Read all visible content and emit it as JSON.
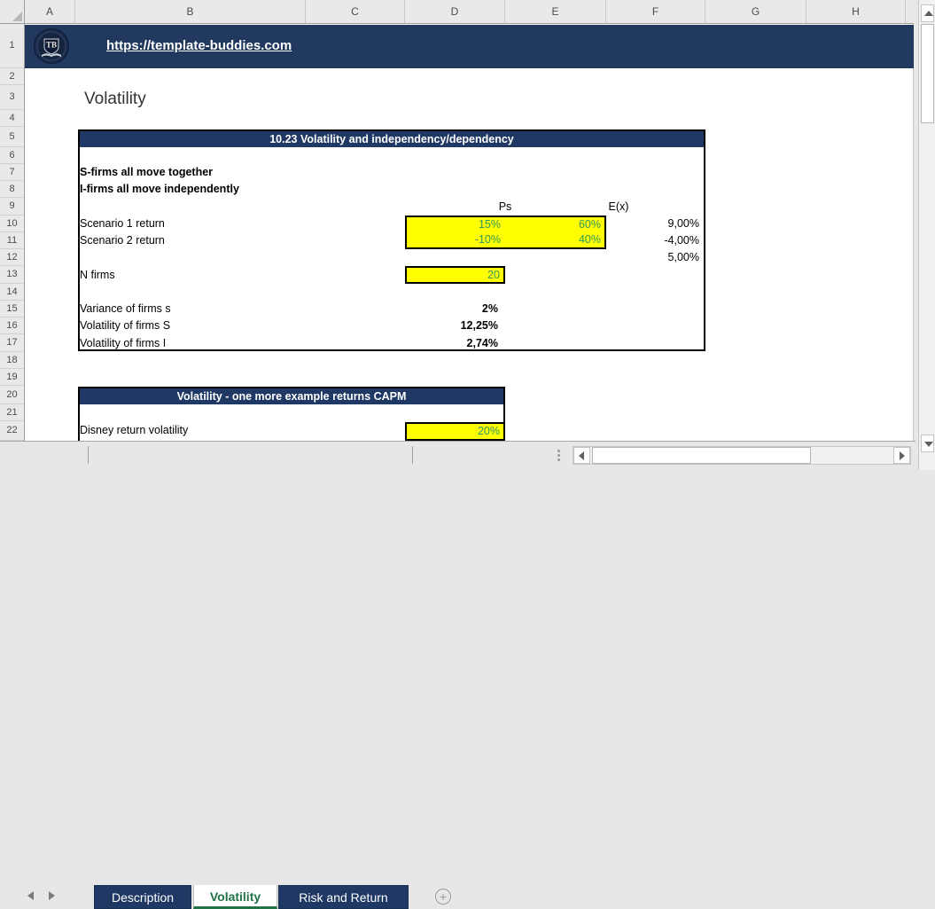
{
  "banner": {
    "url": "https://template-buddies.com",
    "logo_monogram": "TB"
  },
  "page_title": "Volatility",
  "grid": {
    "columns": [
      "A",
      "B",
      "C",
      "D",
      "E",
      "F",
      "G",
      "H"
    ],
    "rows": [
      "1",
      "2",
      "3",
      "4",
      "5",
      "6",
      "7",
      "8",
      "9",
      "10",
      "11",
      "12",
      "13",
      "14",
      "15",
      "16",
      "17",
      "18",
      "19",
      "20",
      "21",
      "22"
    ]
  },
  "table1": {
    "title": "10.23 Volatility and independency/dependency",
    "note_line1": "S-firms all move together",
    "note_line2": "I-firms all move independently",
    "header_ps": "Ps",
    "header_ex": "E(x)",
    "rows": {
      "scenario1": {
        "label": "Scenario 1 return",
        "prob": "15%",
        "weight": "60%",
        "expected": "9,00%"
      },
      "scenario2": {
        "label": "Scenario 2 return",
        "prob": "-10%",
        "weight": "40%",
        "expected": "-4,00%"
      },
      "expected_sum": "5,00%",
      "n_firms": {
        "label": "N firms",
        "value": "20"
      }
    },
    "stats": [
      {
        "label": "Variance of firms s",
        "value": "2%"
      },
      {
        "label": "Volatility of firms S",
        "value": "12,25%"
      },
      {
        "label": "Volatility of firms I",
        "value": "2,74%"
      }
    ]
  },
  "table2": {
    "title": "Volatility - one more example returns CAPM",
    "rows": {
      "disney": {
        "label": "Disney return volatility",
        "value": "20%"
      }
    }
  },
  "sheet_tabs": {
    "items": [
      {
        "label": "Description"
      },
      {
        "label": "Volatility"
      },
      {
        "label": "Risk and Return"
      }
    ],
    "active": "Volatility"
  },
  "icons": {
    "new_sheet_icon": "+"
  },
  "colors": {
    "navy": "#1F3864",
    "input_fill": "#FFFF00",
    "input_text": "#2E9960",
    "active_tab_green": "#217346"
  }
}
